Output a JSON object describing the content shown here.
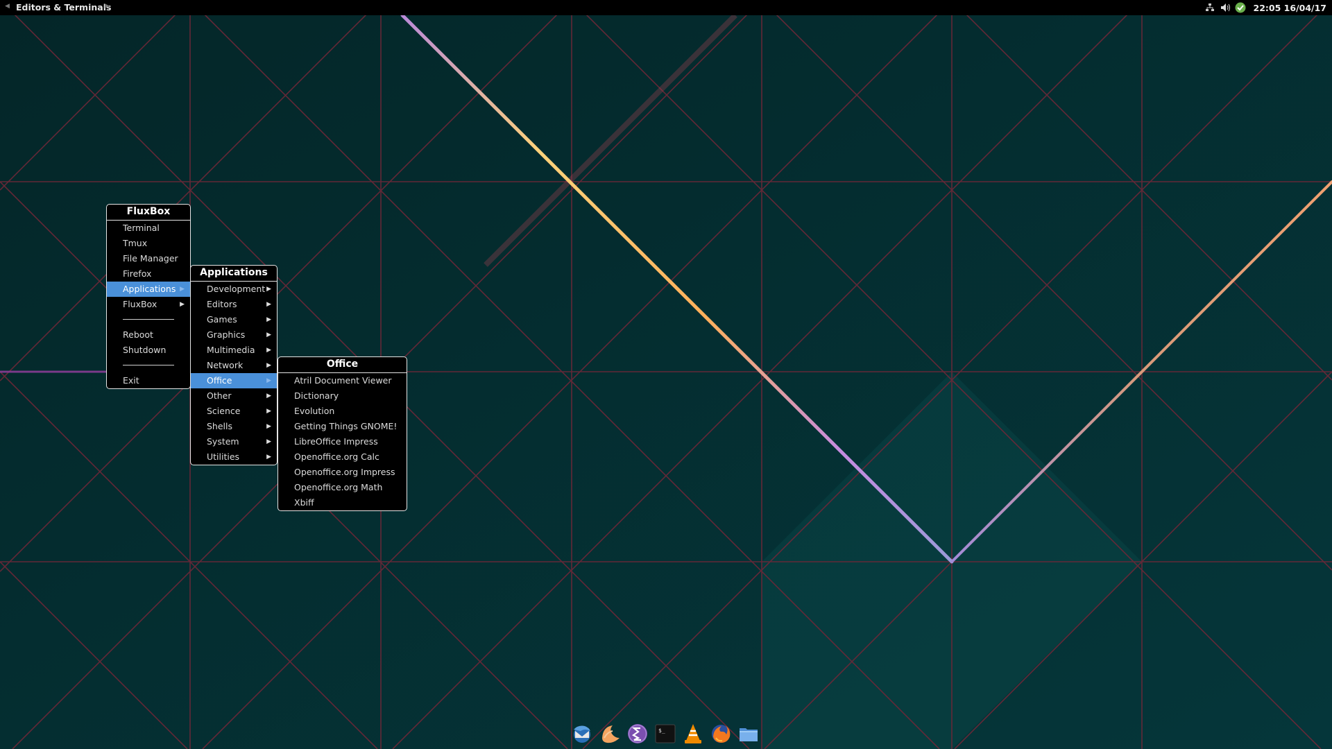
{
  "topbar": {
    "workspace_name": "Editors & Terminals",
    "prev_icon": "triangle-left-icon",
    "next_icon": "triangle-right-icon",
    "tray_icons": [
      "network-icon",
      "volume-icon",
      "update-shield-icon"
    ],
    "clock": "22:05 16/04/17"
  },
  "menu_root": {
    "title": "FluxBox",
    "items": {
      "terminal": "Terminal",
      "tmux": "Tmux",
      "file_manager": "File Manager",
      "firefox": "Firefox",
      "applications": "Applications",
      "fluxbox": "FluxBox",
      "reboot": "Reboot",
      "shutdown": "Shutdown",
      "exit": "Exit"
    }
  },
  "menu_applications": {
    "title": "Applications",
    "items": [
      "Development",
      "Editors",
      "Games",
      "Graphics",
      "Multimedia",
      "Network",
      "Office",
      "Other",
      "Science",
      "Shells",
      "System",
      "Utilities"
    ],
    "active": "Office"
  },
  "menu_office": {
    "title": "Office",
    "items": [
      "Atril Document Viewer",
      "Dictionary",
      "Evolution",
      "Getting Things GNOME!",
      "LibreOffice Impress",
      "Openoffice.org Calc",
      "Openoffice.org Impress",
      "Openoffice.org Math",
      "Xbiff"
    ]
  },
  "dock": {
    "icons": [
      "thunderbird-icon",
      "sublime-icon",
      "emacs-icon",
      "terminal-icon",
      "vlc-icon",
      "firefox-icon",
      "files-icon"
    ]
  },
  "colors": {
    "background": "#032a2d",
    "menu_bg": "#000000",
    "menu_border": "#e6e6e6",
    "highlight": "#4a90d9",
    "wallpaper_line": "#7a2c3e"
  }
}
